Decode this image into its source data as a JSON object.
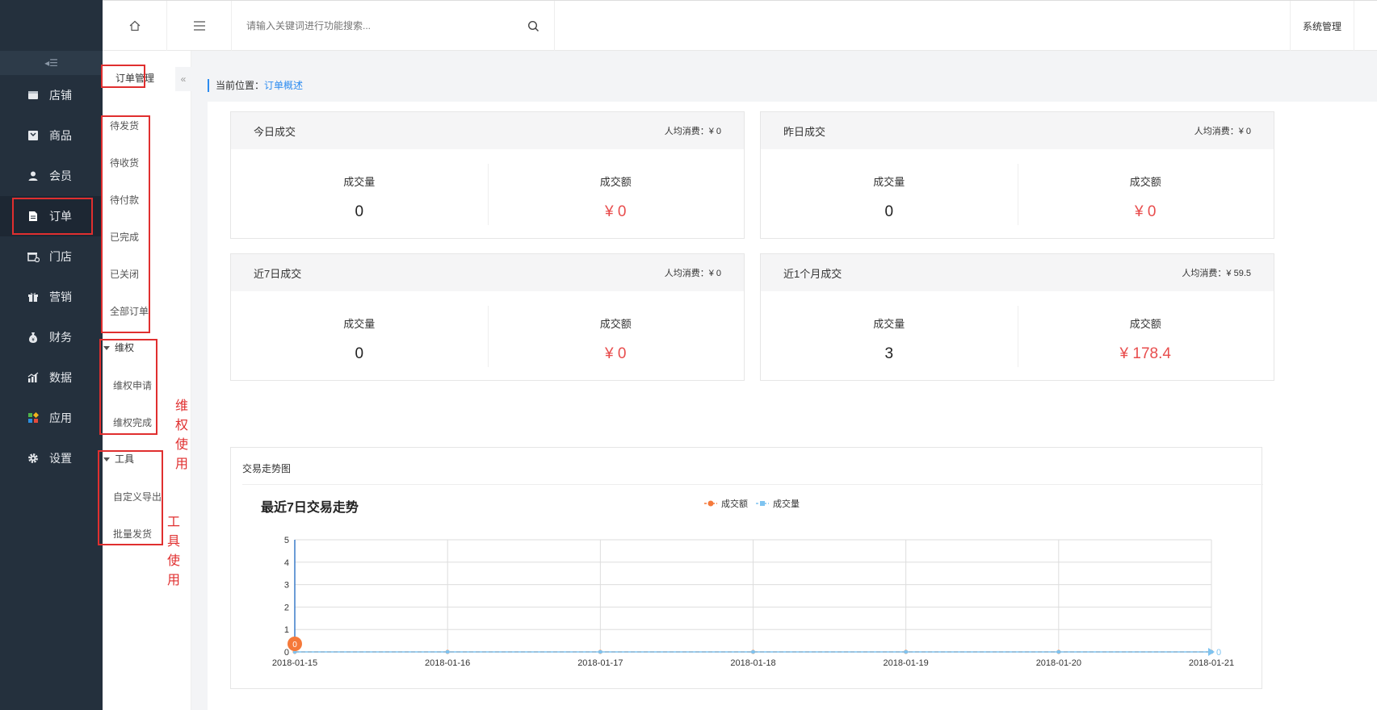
{
  "sidebar": {
    "collapse_glyph": "◂☰",
    "items": [
      {
        "label": "店铺",
        "icon": "store-icon"
      },
      {
        "label": "商品",
        "icon": "goods-icon"
      },
      {
        "label": "会员",
        "icon": "user-icon"
      },
      {
        "label": "订单",
        "icon": "document-icon",
        "active": true
      },
      {
        "label": "门店",
        "icon": "shop-icon"
      },
      {
        "label": "营销",
        "icon": "gift-icon"
      },
      {
        "label": "财务",
        "icon": "money-bag-icon"
      },
      {
        "label": "数据",
        "icon": "bar-chart-icon"
      },
      {
        "label": "应用",
        "icon": "apps-icon"
      },
      {
        "label": "设置",
        "icon": "gear-icon"
      }
    ]
  },
  "subnav": {
    "title": "订单管理",
    "toggle": "«",
    "links": [
      "待发货",
      "待收货",
      "待付款",
      "已完成",
      "已关闭",
      "全部订单"
    ],
    "group_rights": {
      "label": "维权",
      "links": [
        "维权申请",
        "维权完成"
      ]
    },
    "group_tools": {
      "label": "工具",
      "links": [
        "自定义导出",
        "批量发货"
      ]
    }
  },
  "annotations": {
    "rights": "维权使用",
    "tools": "工具使用"
  },
  "topbar": {
    "search_placeholder": "请输入关键词进行功能搜索...",
    "system_label": "系统管理"
  },
  "breadcrumb": {
    "prefix": "当前位置：",
    "current": "订单概述"
  },
  "cards": [
    {
      "title": "今日成交",
      "avg": "人均消费：¥ 0",
      "count_label": "成交量",
      "count": "0",
      "amount_label": "成交额",
      "amount": "¥ 0"
    },
    {
      "title": "昨日成交",
      "avg": "人均消费：¥ 0",
      "count_label": "成交量",
      "count": "0",
      "amount_label": "成交额",
      "amount": "¥ 0"
    },
    {
      "title": "近7日成交",
      "avg": "人均消费：¥ 0",
      "count_label": "成交量",
      "count": "0",
      "amount_label": "成交额",
      "amount": "¥ 0"
    },
    {
      "title": "近1个月成交",
      "avg": "人均消费：¥ 59.5",
      "count_label": "成交量",
      "count": "3",
      "amount_label": "成交额",
      "amount": "¥ 178.4"
    }
  ],
  "chart_section": {
    "label": "交易走势图"
  },
  "chart_data": {
    "type": "line",
    "title": "最近7日交易走势",
    "x": [
      "2018-01-15",
      "2018-01-16",
      "2018-01-17",
      "2018-01-18",
      "2018-01-19",
      "2018-01-20",
      "2018-01-21"
    ],
    "ylim": [
      0,
      5
    ],
    "yticks": [
      "0",
      "1",
      "2",
      "3",
      "4",
      "5"
    ],
    "series": [
      {
        "name": "成交额",
        "values": [
          0,
          0,
          0,
          0,
          0,
          0,
          0
        ],
        "color": "#f5793a",
        "marker": "circle"
      },
      {
        "name": "成交量",
        "values": [
          0,
          0,
          0,
          0,
          0,
          0,
          0
        ],
        "color": "#7ec3f0",
        "marker": "square"
      }
    ],
    "point_labels": {
      "start": "0",
      "end": "0"
    },
    "grid": true,
    "legend": "top-center"
  }
}
